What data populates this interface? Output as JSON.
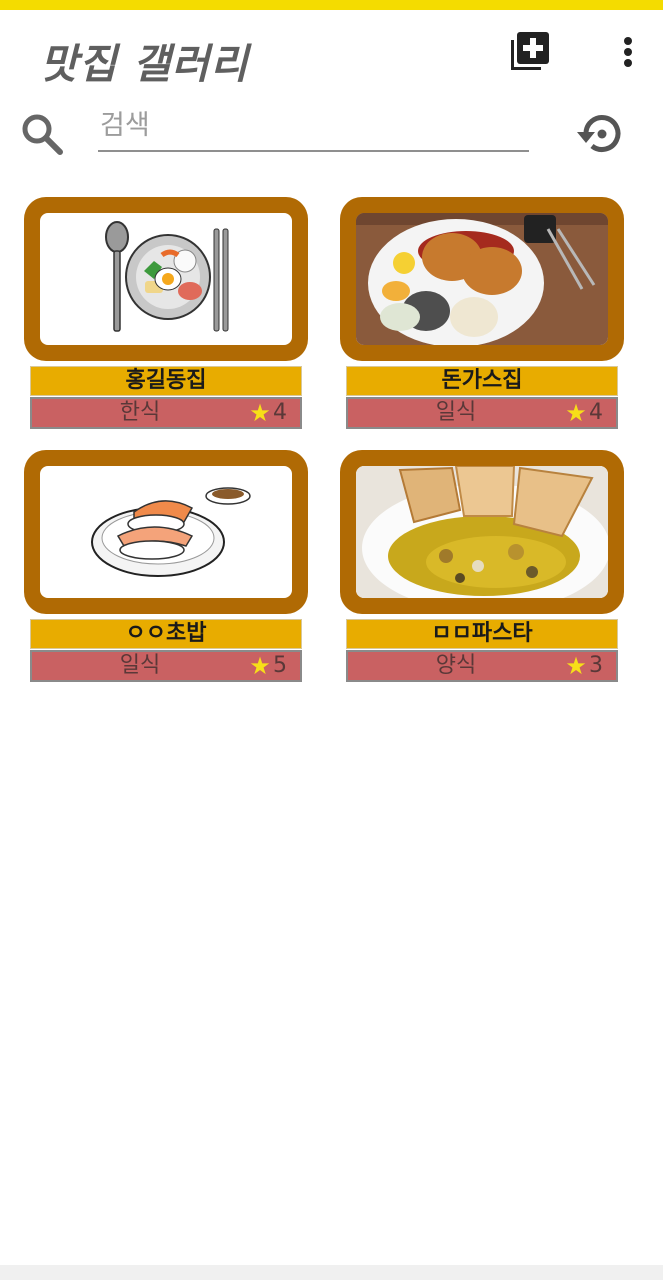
{
  "app": {
    "title": "맛집 갤러리",
    "accent_color": "#f4dc00"
  },
  "header": {
    "add_icon": "library-add-icon",
    "more_icon": "more-vertical-icon"
  },
  "search": {
    "icon": "search-icon",
    "placeholder": "검색",
    "value": "",
    "reset_icon": "restore-icon"
  },
  "restaurants": [
    {
      "name": "홍길동집",
      "category": "한식",
      "rating": "4",
      "image": "bibimbap-illustration"
    },
    {
      "name": "돈가스집",
      "category": "일식",
      "rating": "4",
      "image": "tonkatsu-photo"
    },
    {
      "name": "ㅇㅇ초밥",
      "category": "일식",
      "rating": "5",
      "image": "sushi-illustration"
    },
    {
      "name": "ㅁㅁ파스타",
      "category": "양식",
      "rating": "3",
      "image": "pasta-photo"
    }
  ],
  "colors": {
    "card_frame": "#b06a04",
    "name_bar": "#e8ac00",
    "meta_bar": "#c96162",
    "star": "#f7df18"
  }
}
